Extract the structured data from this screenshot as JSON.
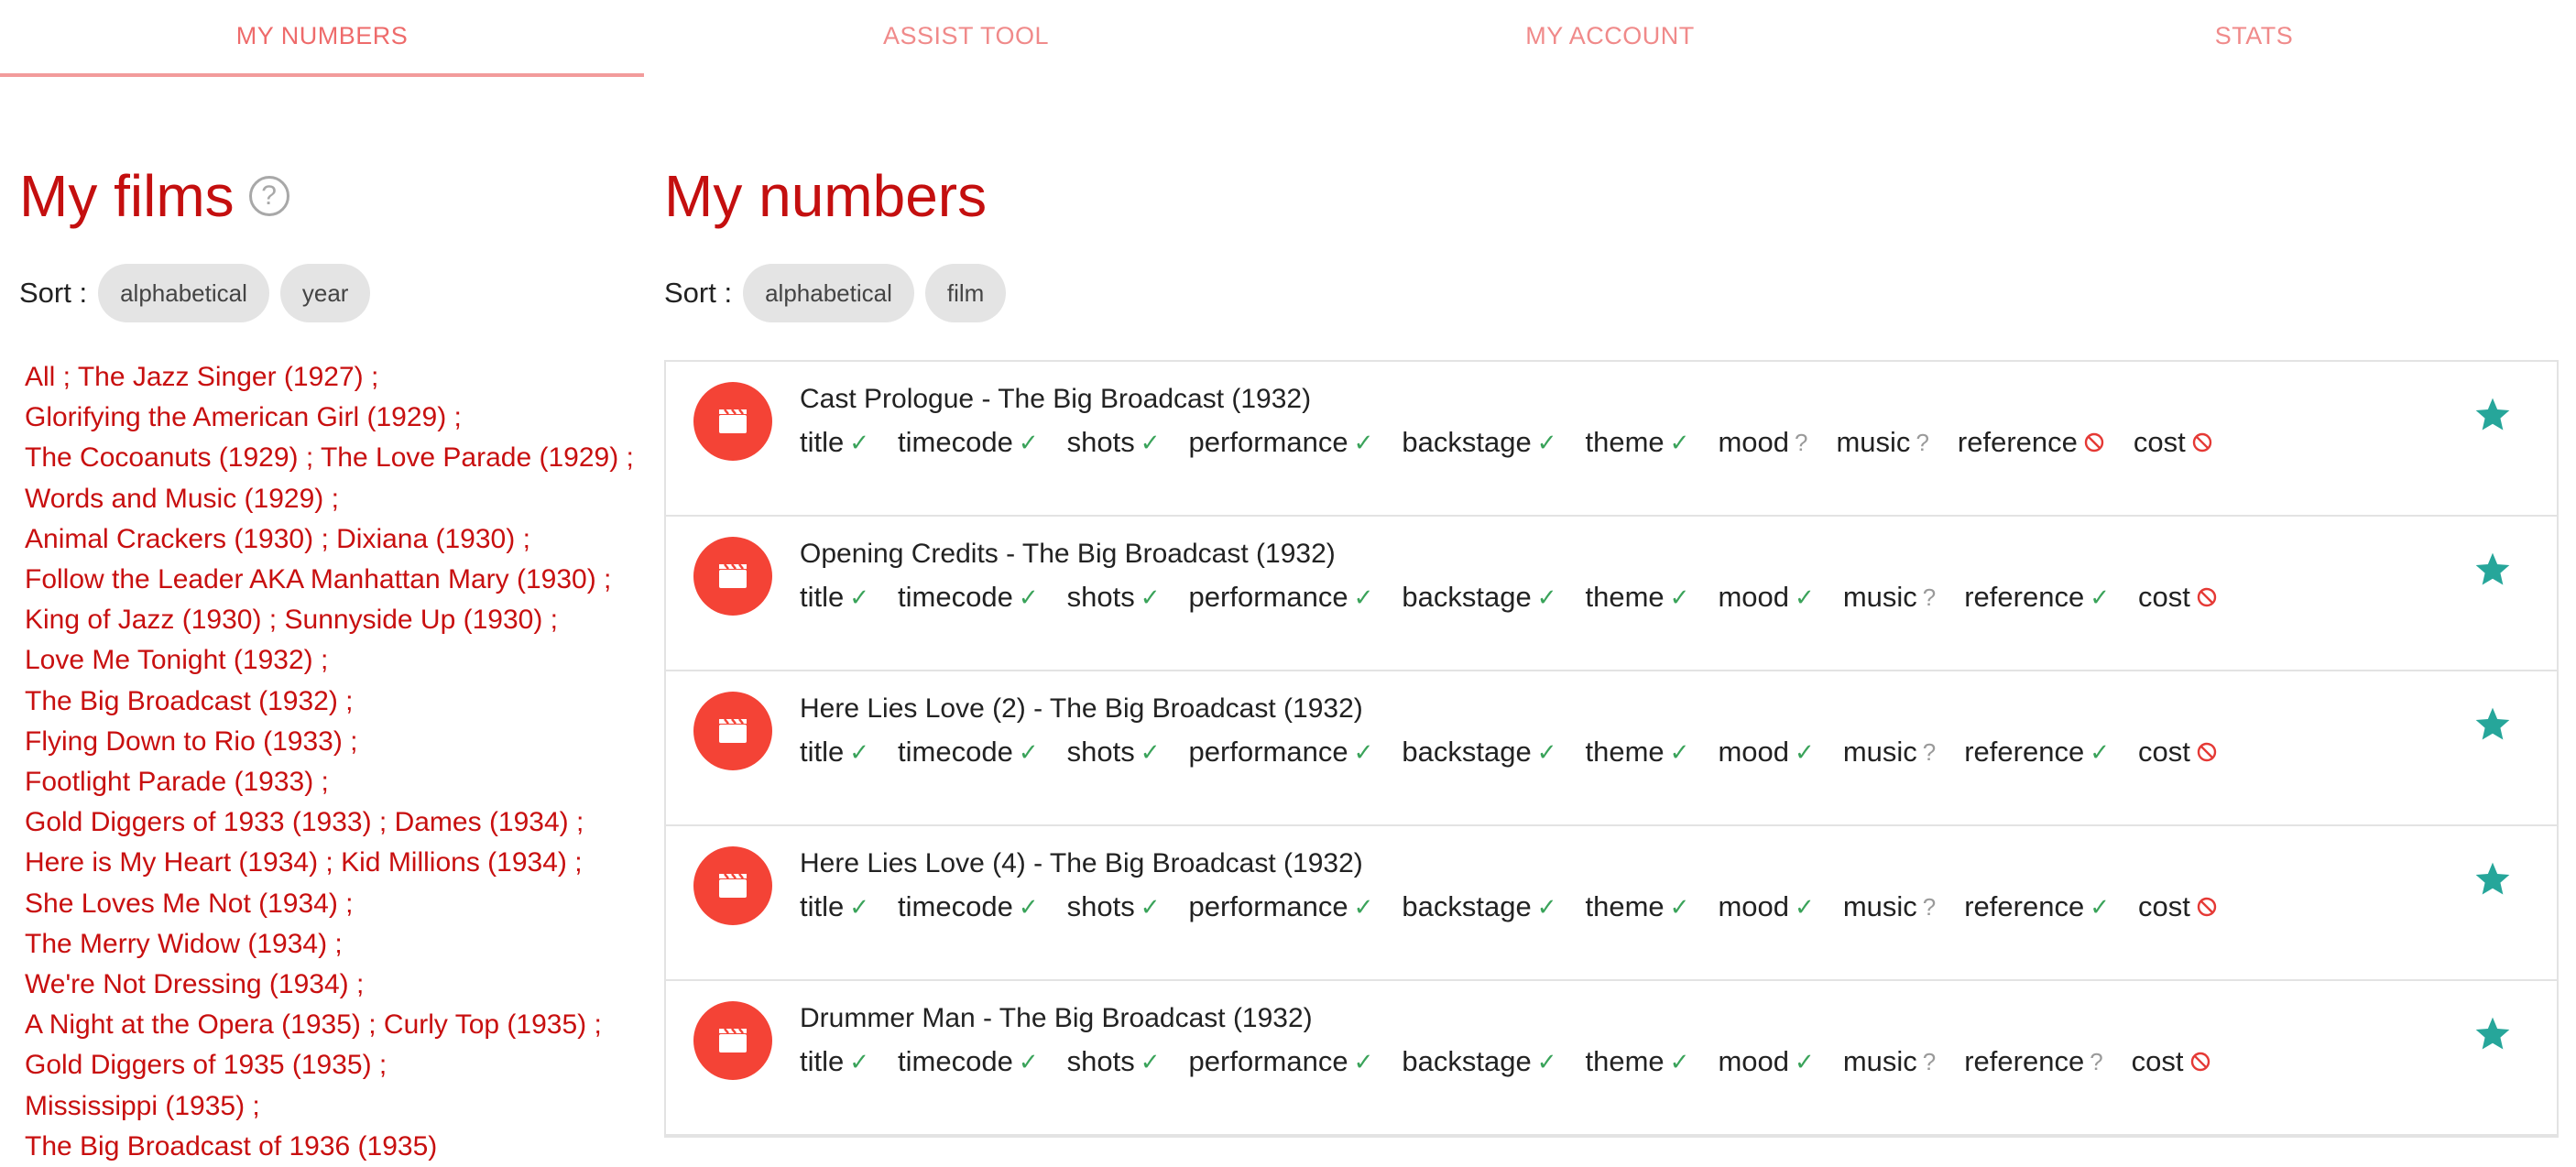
{
  "tabs": [
    {
      "label": "MY NUMBERS"
    },
    {
      "label": "ASSIST TOOL"
    },
    {
      "label": "MY ACCOUNT"
    },
    {
      "label": "STATS"
    }
  ],
  "films_panel": {
    "title": "My films",
    "help": "?",
    "sort_label": "Sort :",
    "sort_options": [
      "alphabetical",
      "year"
    ],
    "lines": [
      [
        "All ;",
        "The Jazz Singer (1927) ;"
      ],
      [
        "Glorifying the American Girl (1929) ;"
      ],
      [
        "The Cocoanuts (1929) ;",
        "The Love Parade (1929) ;"
      ],
      [
        "Words and Music (1929) ;"
      ],
      [
        "Animal Crackers (1930) ;",
        "Dixiana (1930) ;"
      ],
      [
        "Follow the Leader AKA Manhattan Mary (1930) ;"
      ],
      [
        "King of Jazz (1930) ;",
        "Sunnyside Up (1930) ;"
      ],
      [
        "Love Me Tonight (1932) ;"
      ],
      [
        "The Big Broadcast (1932) ;"
      ],
      [
        "Flying Down to Rio (1933) ;"
      ],
      [
        "Footlight Parade (1933) ;"
      ],
      [
        "Gold Diggers of 1933 (1933) ;",
        "Dames (1934) ;"
      ],
      [
        "Here is My Heart (1934) ;",
        "Kid Millions (1934) ;"
      ],
      [
        "She Loves Me Not (1934) ;"
      ],
      [
        "The Merry Widow (1934) ;"
      ],
      [
        "We're Not Dressing (1934) ;"
      ],
      [
        "A Night at the Opera (1935) ;",
        "Curly Top (1935) ;"
      ],
      [
        "Gold Diggers of 1935 (1935) ;"
      ],
      [
        "Mississippi (1935) ;"
      ],
      [
        "The Big Broadcast of 1936 (1935)"
      ]
    ]
  },
  "numbers_panel": {
    "title": "My numbers",
    "sort_label": "Sort :",
    "sort_options": [
      "alphabetical",
      "film"
    ],
    "status_symbols": {
      "ok": "✓",
      "unknown": "?",
      "none": "⃠"
    },
    "colors": {
      "ok": "#3aa35a",
      "unknown": "#9a9a9a",
      "none": "#e53935",
      "star": "#26a69a",
      "film_icon": "#f44336"
    },
    "rows": [
      {
        "title": "Cast Prologue - The Big Broadcast (1932)",
        "tags": [
          [
            "title",
            "ok"
          ],
          [
            "timecode",
            "ok"
          ],
          [
            "shots",
            "ok"
          ],
          [
            "performance",
            "ok"
          ],
          [
            "backstage",
            "ok"
          ],
          [
            "theme",
            "ok"
          ],
          [
            "mood",
            "unknown"
          ],
          [
            "music",
            "unknown"
          ],
          [
            "reference",
            "none"
          ],
          [
            "cost",
            "none"
          ]
        ]
      },
      {
        "title": "Opening Credits - The Big Broadcast (1932)",
        "tags": [
          [
            "title",
            "ok"
          ],
          [
            "timecode",
            "ok"
          ],
          [
            "shots",
            "ok"
          ],
          [
            "performance",
            "ok"
          ],
          [
            "backstage",
            "ok"
          ],
          [
            "theme",
            "ok"
          ],
          [
            "mood",
            "ok"
          ],
          [
            "music",
            "unknown"
          ],
          [
            "reference",
            "ok"
          ],
          [
            "cost",
            "none"
          ]
        ]
      },
      {
        "title": "Here Lies Love (2) - The Big Broadcast (1932)",
        "tags": [
          [
            "title",
            "ok"
          ],
          [
            "timecode",
            "ok"
          ],
          [
            "shots",
            "ok"
          ],
          [
            "performance",
            "ok"
          ],
          [
            "backstage",
            "ok"
          ],
          [
            "theme",
            "ok"
          ],
          [
            "mood",
            "ok"
          ],
          [
            "music",
            "unknown"
          ],
          [
            "reference",
            "ok"
          ],
          [
            "cost",
            "none"
          ]
        ]
      },
      {
        "title": "Here Lies Love (4) - The Big Broadcast (1932)",
        "tags": [
          [
            "title",
            "ok"
          ],
          [
            "timecode",
            "ok"
          ],
          [
            "shots",
            "ok"
          ],
          [
            "performance",
            "ok"
          ],
          [
            "backstage",
            "ok"
          ],
          [
            "theme",
            "ok"
          ],
          [
            "mood",
            "ok"
          ],
          [
            "music",
            "unknown"
          ],
          [
            "reference",
            "ok"
          ],
          [
            "cost",
            "none"
          ]
        ]
      },
      {
        "title": "Drummer Man - The Big Broadcast (1932)",
        "tags": [
          [
            "title",
            "ok"
          ],
          [
            "timecode",
            "ok"
          ],
          [
            "shots",
            "ok"
          ],
          [
            "performance",
            "ok"
          ],
          [
            "backstage",
            "ok"
          ],
          [
            "theme",
            "ok"
          ],
          [
            "mood",
            "ok"
          ],
          [
            "music",
            "unknown"
          ],
          [
            "reference",
            "unknown"
          ],
          [
            "cost",
            "none"
          ]
        ]
      }
    ]
  }
}
